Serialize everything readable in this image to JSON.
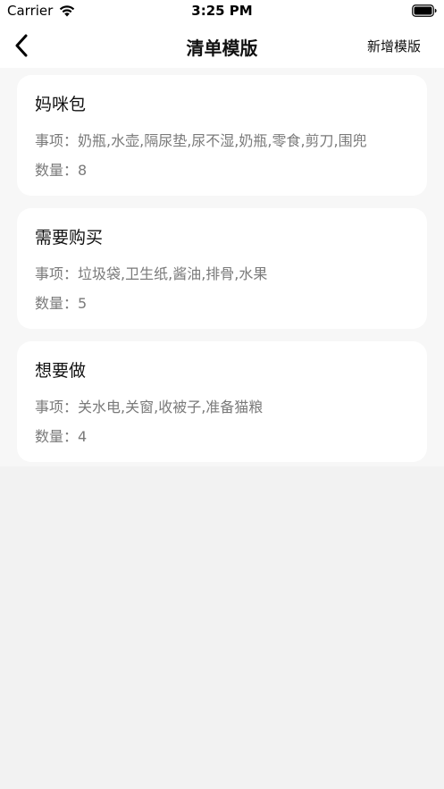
{
  "status_bar": {
    "carrier": "Carrier",
    "time": "3:25 PM"
  },
  "nav": {
    "title": "清单模版",
    "action_label": "新增模版"
  },
  "labels": {
    "items_prefix": "事项：",
    "count_prefix": "数量："
  },
  "templates": [
    {
      "title": "妈咪包",
      "items": "奶瓶,水壶,隔尿垫,尿不湿,奶瓶,零食,剪刀,围兜",
      "count": "8"
    },
    {
      "title": "需要购买",
      "items": "垃圾袋,卫生纸,酱油,排骨,水果",
      "count": "5"
    },
    {
      "title": "想要做",
      "items": "关水电,关窗,收被子,准备猫粮",
      "count": "4"
    }
  ]
}
